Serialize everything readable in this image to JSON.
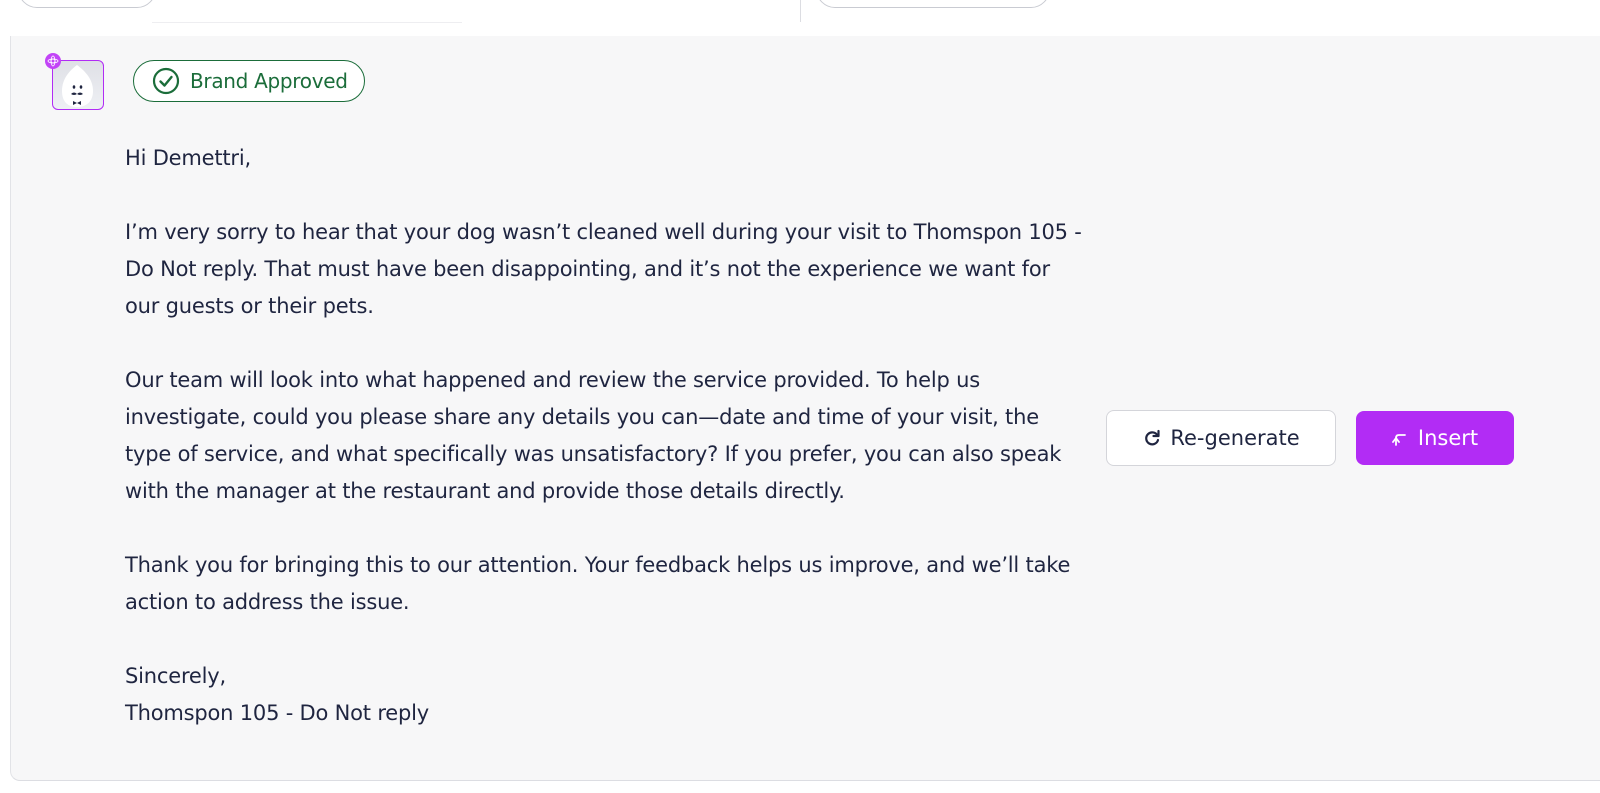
{
  "badge": {
    "label": "Brand Approved",
    "color": "#1b6d3a",
    "icon": "check-circle-icon"
  },
  "avatar": {
    "icon": "mascot-avatar-icon",
    "accent": "#b22cf5"
  },
  "message": {
    "greeting": "Hi Demettri,",
    "paragraphs": [
      "I’m very sorry to hear that your dog wasn’t cleaned well during your visit to Thomspon 105 - Do Not reply. That must have been disappointing, and it’s not the experience we want for our guests or their pets.",
      "Our team will look into what happened and review the service provided. To help us investigate, could you please share any details you can—date and time of your visit, the type of service, and what specifically was unsatisfactory? If you prefer, you can also speak with the manager at the restaurant and provide those details directly.",
      "Thank you for bringing this to our attention. Your feedback helps us improve, and we’ll take action to address the issue."
    ],
    "closing": "Sincerely,",
    "signature": "Thomspon 105 - Do Not reply"
  },
  "actions": {
    "regenerate_label": "Re-generate",
    "regenerate_icon": "refresh-icon",
    "insert_label": "Insert",
    "insert_icon": "insert-arrow-icon",
    "insert_color": "#b22cf5"
  }
}
